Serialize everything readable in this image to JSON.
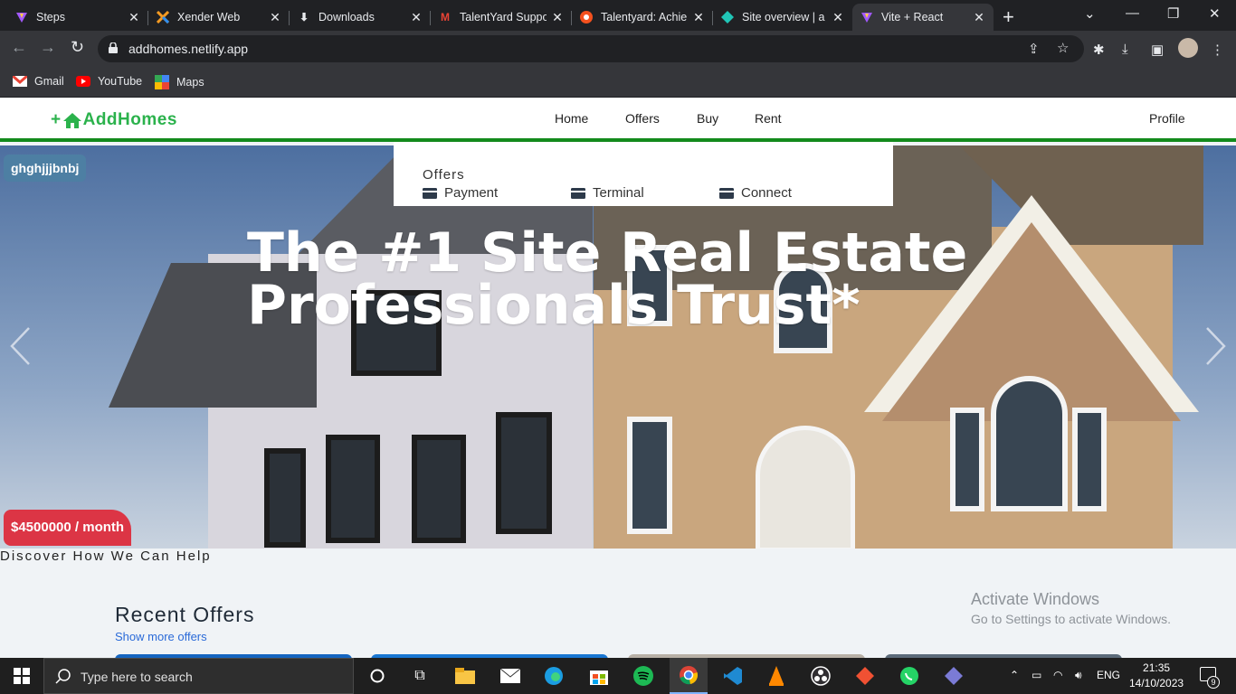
{
  "browser": {
    "tabs": [
      {
        "title": "Steps",
        "icon": "vite-icon"
      },
      {
        "title": "Xender Web",
        "icon": "xender-icon"
      },
      {
        "title": "Downloads",
        "icon": "download-icon"
      },
      {
        "title": "TalentYard Suppo",
        "icon": "gmail-icon"
      },
      {
        "title": "Talentyard: Achie",
        "icon": "talentyard-icon"
      },
      {
        "title": "Site overview | a",
        "icon": "netlify-icon"
      },
      {
        "title": "Vite + React",
        "icon": "vite-icon"
      }
    ],
    "url": "addhomes.netlify.app",
    "bookmarks": [
      {
        "label": "Gmail"
      },
      {
        "label": "YouTube"
      },
      {
        "label": "Maps"
      }
    ]
  },
  "site": {
    "logo_prefix": "+",
    "logo_text": "AddHomes",
    "nav": {
      "home": "Home",
      "offers": "Offers",
      "buy": "Buy",
      "rent": "Rent",
      "profile": "Profile"
    },
    "dropdown": {
      "heading": "Offers",
      "items": [
        "Payment",
        "Terminal",
        "Connect"
      ]
    },
    "hero": {
      "tag": "ghghjjjbnbj",
      "title_line1": "The #1 Site Real Estate",
      "title_line2": "Professionals Trust*",
      "price": "$4500000 / month"
    },
    "help_text": "Discover How We Can Help",
    "recent_title": "Recent Offers",
    "show_more": "Show more offers",
    "watermark": {
      "line1": "Activate Windows",
      "line2": "Go to Settings to activate Windows."
    }
  },
  "taskbar": {
    "search_placeholder": "Type here to search",
    "lang": "ENG",
    "time": "21:35",
    "date": "14/10/2023",
    "notifications": "9"
  },
  "colors": {
    "brand_green": "#2bb24c",
    "nav_border": "#138a1c",
    "price_red": "#dc3545",
    "tag_blue": "#4d7fa3",
    "link_blue": "#2a6ad8"
  }
}
